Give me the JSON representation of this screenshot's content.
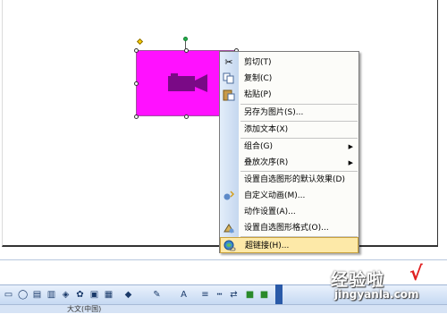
{
  "context_menu": {
    "items": [
      {
        "label": "剪切(T)",
        "icon": "scissors-icon",
        "highlighted": false,
        "submenu": false
      },
      {
        "label": "复制(C)",
        "icon": "copy-icon",
        "highlighted": false,
        "submenu": false
      },
      {
        "label": "粘贴(P)",
        "icon": "paste-icon",
        "highlighted": false,
        "submenu": false
      },
      {
        "label": "另存为图片(S)...",
        "icon": "",
        "highlighted": false,
        "submenu": false
      },
      {
        "label": "添加文本(X)",
        "icon": "",
        "highlighted": false,
        "submenu": false
      },
      {
        "label": "组合(G)",
        "icon": "",
        "highlighted": false,
        "submenu": true
      },
      {
        "label": "叠放次序(R)",
        "icon": "",
        "highlighted": false,
        "submenu": true
      },
      {
        "label": "设置自选图形的默认效果(D)",
        "icon": "",
        "highlighted": false,
        "submenu": false
      },
      {
        "label": "自定义动画(M)...",
        "icon": "custom-animation-icon",
        "highlighted": false,
        "submenu": false
      },
      {
        "label": "动作设置(A)...",
        "icon": "",
        "highlighted": false,
        "submenu": false
      },
      {
        "label": "设置自选图形格式(O)...",
        "icon": "format-shape-icon",
        "highlighted": false,
        "submenu": false
      },
      {
        "label": "超链接(H)...",
        "icon": "hyperlink-icon",
        "highlighted": true,
        "submenu": false
      }
    ]
  },
  "shape": {
    "fill_color": "#ff11ff",
    "icon": "video-camera-icon"
  },
  "drawing_toolbar": {
    "icons": [
      "rectangle-icon",
      "oval-icon",
      "textbox-icon",
      "vertical-textbox-icon",
      "wordart-icon",
      "diagram-icon",
      "clipart-icon",
      "picture-icon",
      "fill-color-icon",
      "line-color-icon",
      "font-color-icon",
      "line-style-icon",
      "dash-style-icon",
      "arrow-style-icon",
      "shadow-icon",
      "3d-icon"
    ]
  },
  "status": {
    "text": "大文(中国)"
  },
  "watermark": {
    "title": "经验啦",
    "url": "jingyanla.com"
  }
}
